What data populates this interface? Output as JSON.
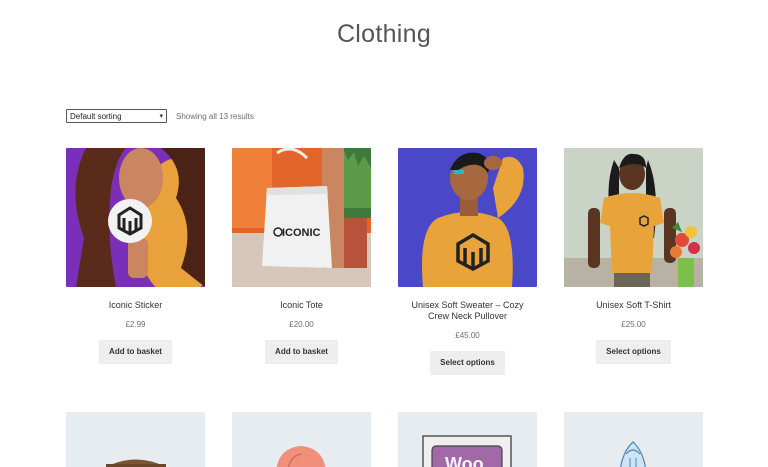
{
  "page": {
    "title": "Clothing"
  },
  "toolbar": {
    "sort_selected": "Default sorting",
    "result_count": "Showing all 13 results"
  },
  "products": [
    {
      "title": "Iconic Sticker",
      "price": "£2.99",
      "button": "Add to basket",
      "image": "purple-background-sticker-photo"
    },
    {
      "title": "Iconic Tote",
      "price": "£20.00",
      "button": "Add to basket",
      "image": "orange-wall-tote-bag-photo"
    },
    {
      "title": "Unisex Soft Sweater – Cozy Crew Neck Pullover",
      "price": "£45.00",
      "button": "Select options",
      "image": "blue-background-sweater-photo"
    },
    {
      "title": "Unisex Soft T-Shirt",
      "price": "£25.00",
      "button": "Select options",
      "image": "green-background-tshirt-photo"
    }
  ],
  "products_row2": [
    {
      "image": "brown-beanie-illustration"
    },
    {
      "image": "pink-cap-illustration"
    },
    {
      "image": "woo-poster-illustration"
    },
    {
      "image": "blue-hoodie-illustration"
    }
  ],
  "colors": {
    "accent_yellow": "#e8a33a",
    "purple_bg": "#7b2fb8",
    "orange_bg": "#e2652a",
    "blue_bg": "#4a48c9",
    "green_bg": "#c9d3c6",
    "button_bg": "#eeeeee"
  }
}
